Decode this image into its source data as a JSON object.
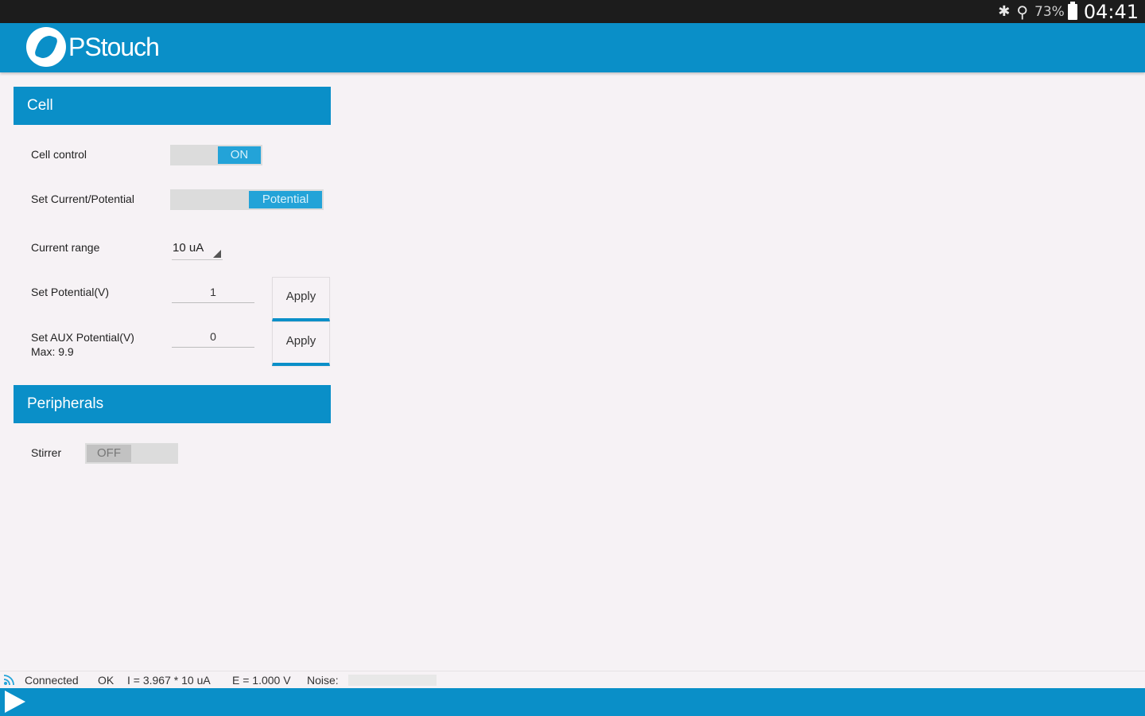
{
  "status_bar": {
    "battery": "73%",
    "time": "04:41",
    "icons": [
      "bluetooth-icon",
      "wifi-icon",
      "battery-icon"
    ]
  },
  "app": {
    "title": "PStouch",
    "accent_color": "#0a8fc8"
  },
  "cell": {
    "header": "Cell",
    "cell_control": {
      "label": "Cell control",
      "value": "ON",
      "state": true
    },
    "mode": {
      "label": "Set Current/Potential",
      "value": "Potential"
    },
    "current_range": {
      "label": "Current range",
      "value": "10 uA"
    },
    "set_potential": {
      "label": "Set Potential(V)",
      "value": "1",
      "apply": "Apply"
    },
    "aux_potential": {
      "label": "Set AUX Potential(V)",
      "sublabel": "Max: 9.9",
      "value": "0",
      "apply": "Apply"
    }
  },
  "peripherals": {
    "header": "Peripherals",
    "stirrer": {
      "label": "Stirrer",
      "value": "OFF",
      "state": false
    }
  },
  "status_line": {
    "connection": "Connected",
    "ok": "OK",
    "current": "I = 3.967 * 10 uA",
    "potential": "E = 1.000 V",
    "noise_label": "Noise:"
  }
}
